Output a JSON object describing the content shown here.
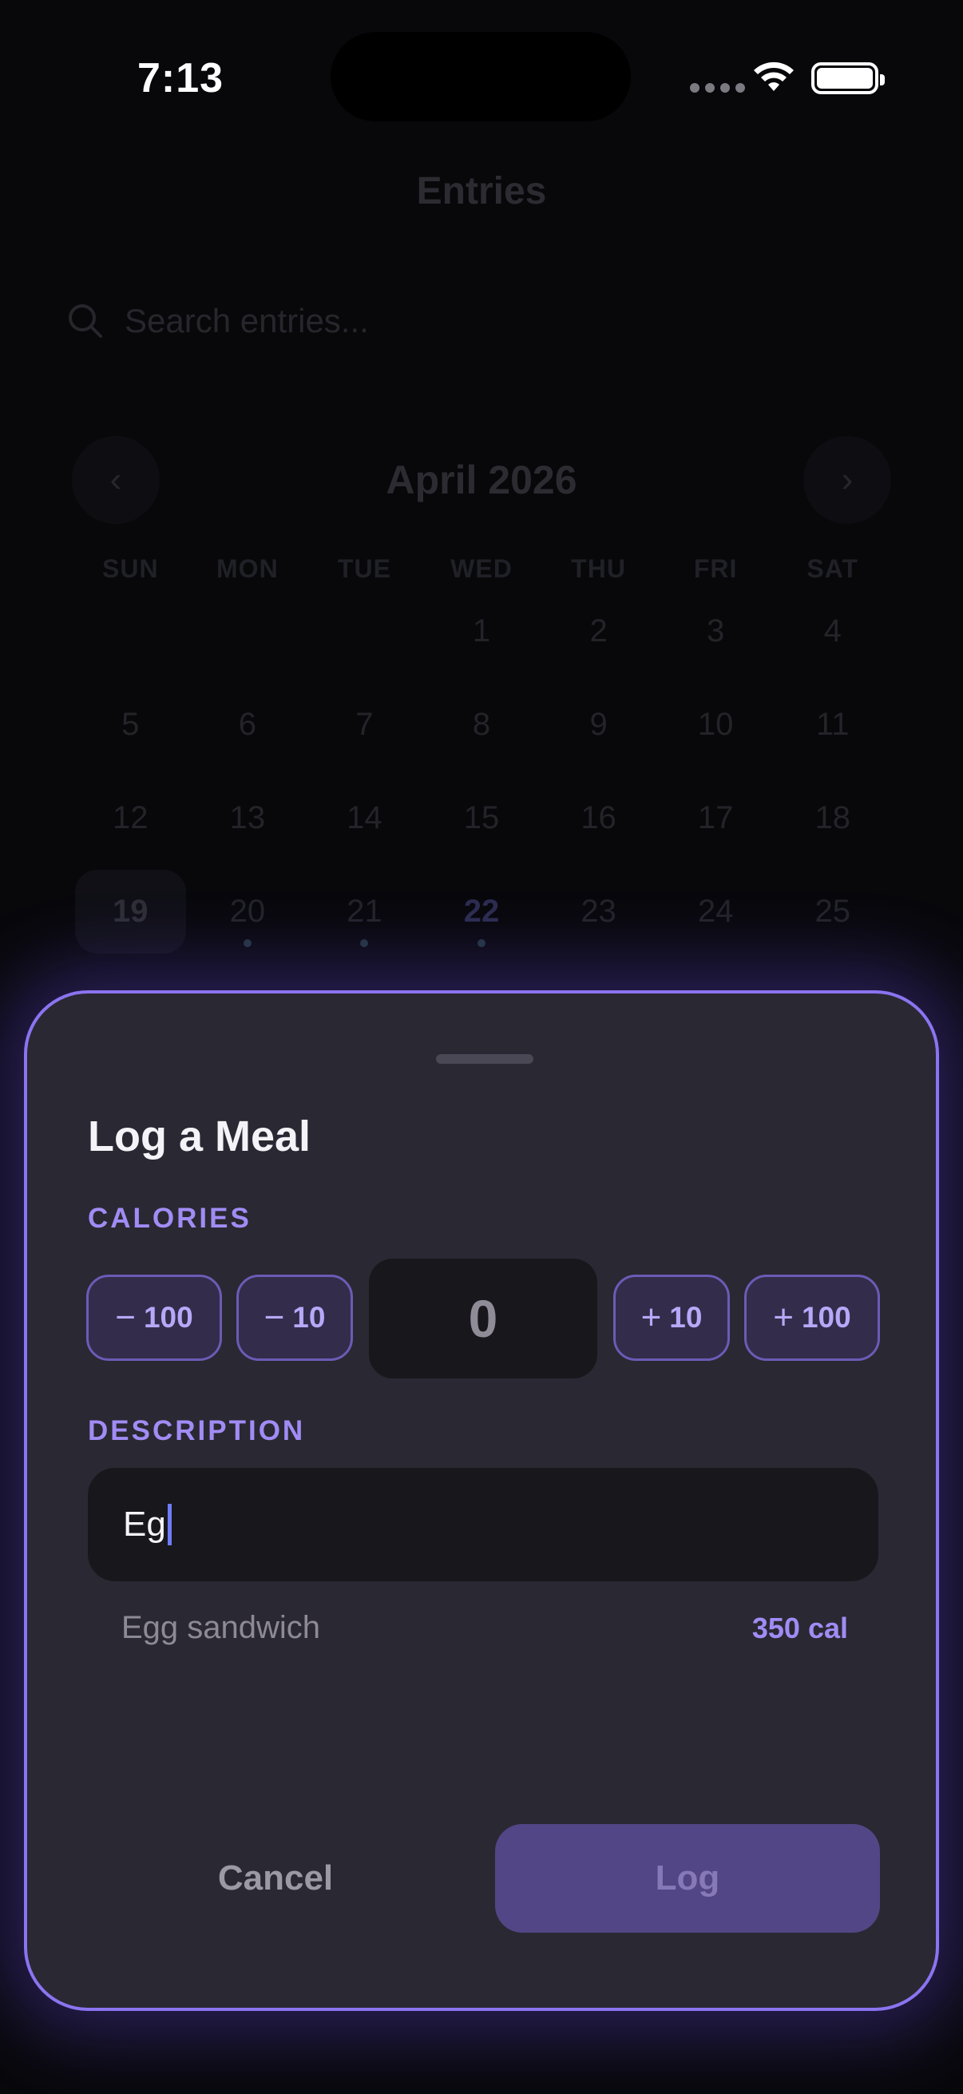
{
  "status_bar": {
    "time": "7:13"
  },
  "background": {
    "title": "Entries",
    "search_placeholder": "Search entries...",
    "calendar": {
      "month": "April 2026",
      "prev_icon": "chevron-left-icon",
      "next_icon": "chevron-right-icon",
      "weekdays": [
        "SUN",
        "MON",
        "TUE",
        "WED",
        "THU",
        "FRI",
        "SAT"
      ],
      "days": [
        "",
        "",
        "",
        "1",
        "2",
        "3",
        "4",
        "5",
        "6",
        "7",
        "8",
        "9",
        "10",
        "11",
        "12",
        "13",
        "14",
        "15",
        "16",
        "17",
        "18",
        "19",
        "20",
        "21",
        "22",
        "23",
        "24",
        "25"
      ],
      "selected_day": "19",
      "today": "22",
      "days_with_entries": [
        "20",
        "21",
        "22"
      ]
    }
  },
  "sheet": {
    "title": "Log a Meal",
    "calories_label": "CALORIES",
    "steppers": {
      "minus100": {
        "sign": "−",
        "amount": "100"
      },
      "minus10": {
        "sign": "−",
        "amount": "10"
      },
      "plus10": {
        "sign": "+",
        "amount": "10"
      },
      "plus100": {
        "sign": "+",
        "amount": "100"
      }
    },
    "calories_value": "0",
    "description_label": "DESCRIPTION",
    "description_value": "Eg",
    "suggestion": {
      "name": "Egg sandwich",
      "calories": "350 cal"
    },
    "cancel_label": "Cancel",
    "log_label": "Log"
  },
  "colors": {
    "accent": "#a18cf5",
    "sheet_border": "#8b74f0",
    "sheet_background": "#2a2832",
    "log_button": "#534686"
  }
}
